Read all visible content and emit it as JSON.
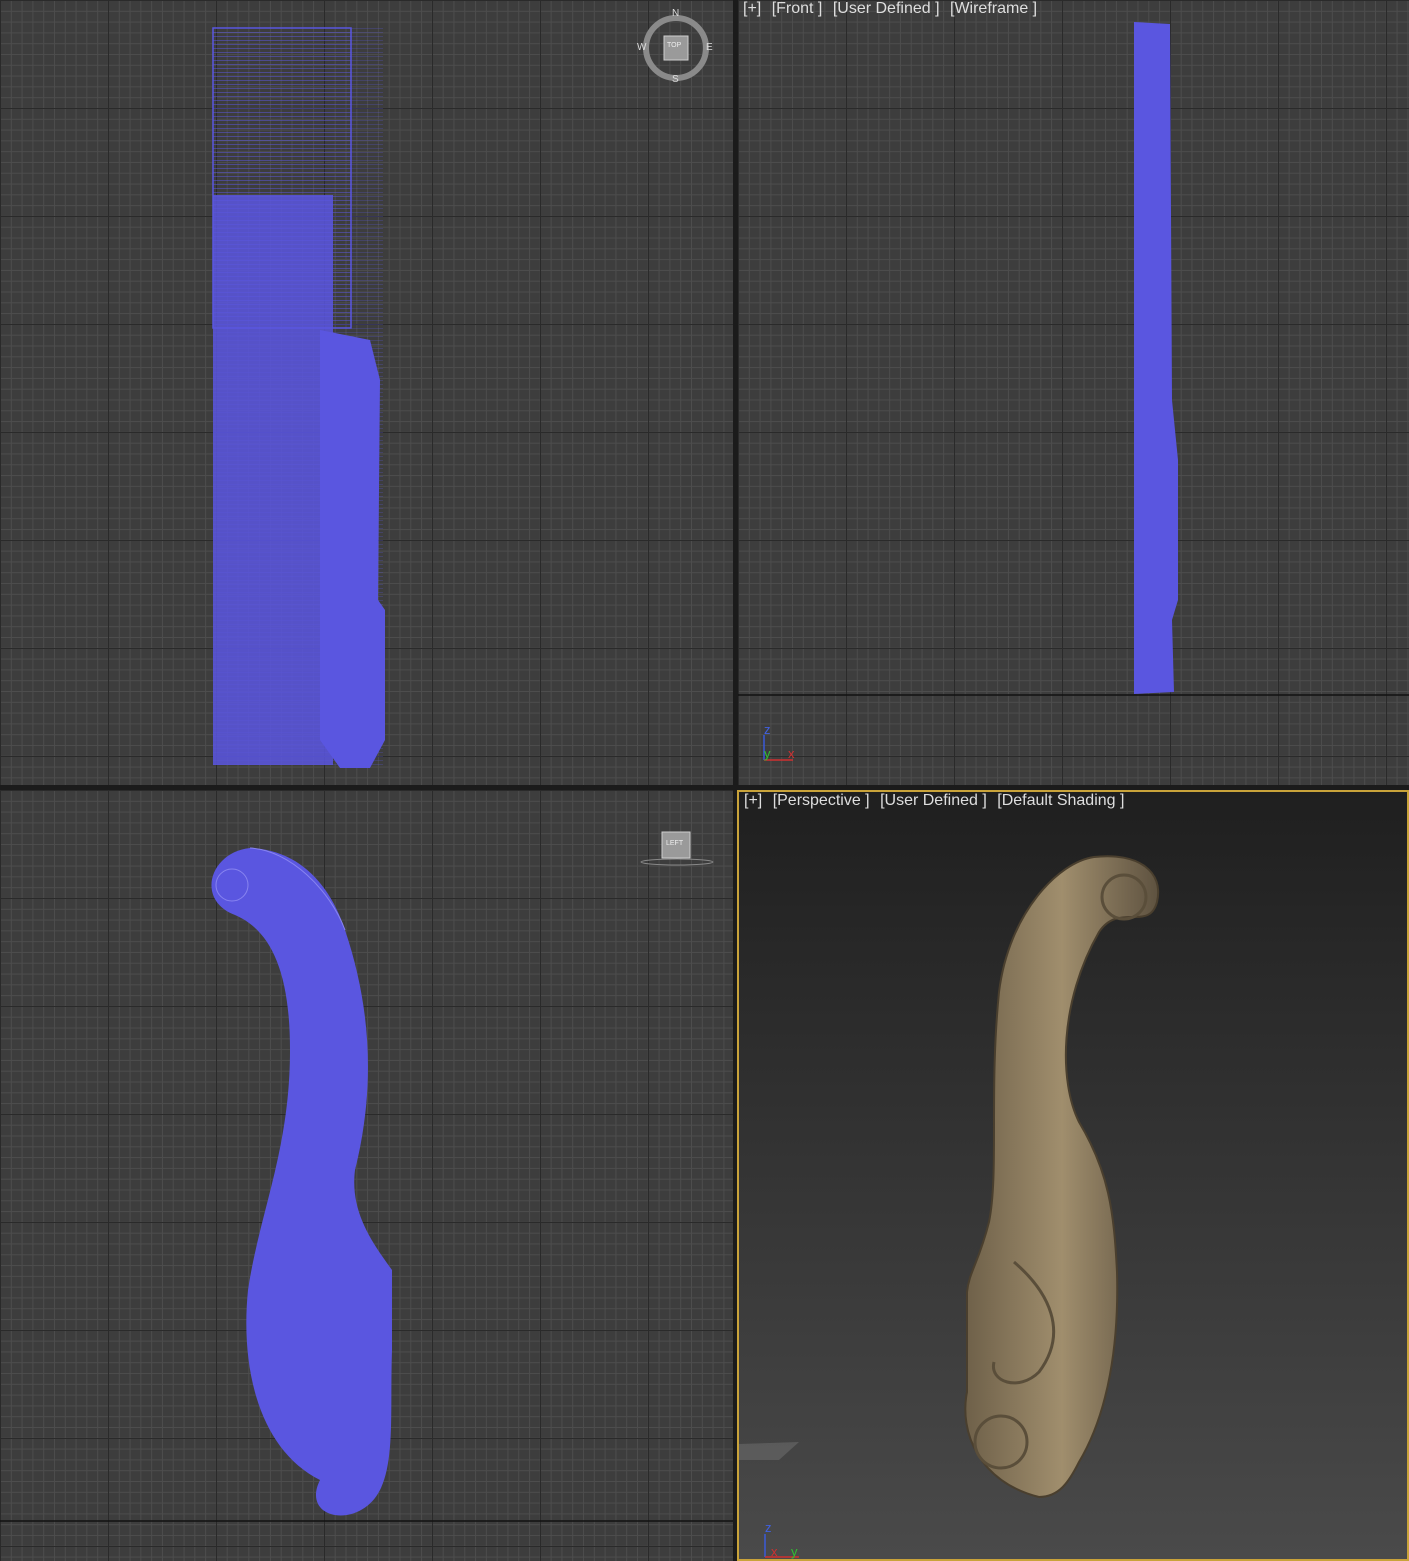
{
  "colors": {
    "wireframe": "#5a56e0",
    "grid_bg": "#3d3d3d",
    "active_border": "#c9a33a",
    "wood": "#8b7a5c"
  },
  "viewports": {
    "top": {
      "label_visible": false,
      "viewcube": {
        "north": "N",
        "south": "S",
        "east": "E",
        "west": "W",
        "face": "TOP"
      }
    },
    "front": {
      "labels": [
        "[+]",
        "[Front ]",
        "[User Defined ]",
        "[Wireframe ]"
      ],
      "axis": {
        "z": "z",
        "y": "y",
        "x": "x"
      }
    },
    "left": {
      "label_visible": false,
      "viewcube": {
        "face": "LEFT"
      }
    },
    "perspective": {
      "labels": [
        "[+]",
        "[Perspective ]",
        "[User Defined ]",
        "[Default Shading ]"
      ],
      "axis": {
        "z": "z",
        "x": "x",
        "y": "y"
      }
    }
  }
}
